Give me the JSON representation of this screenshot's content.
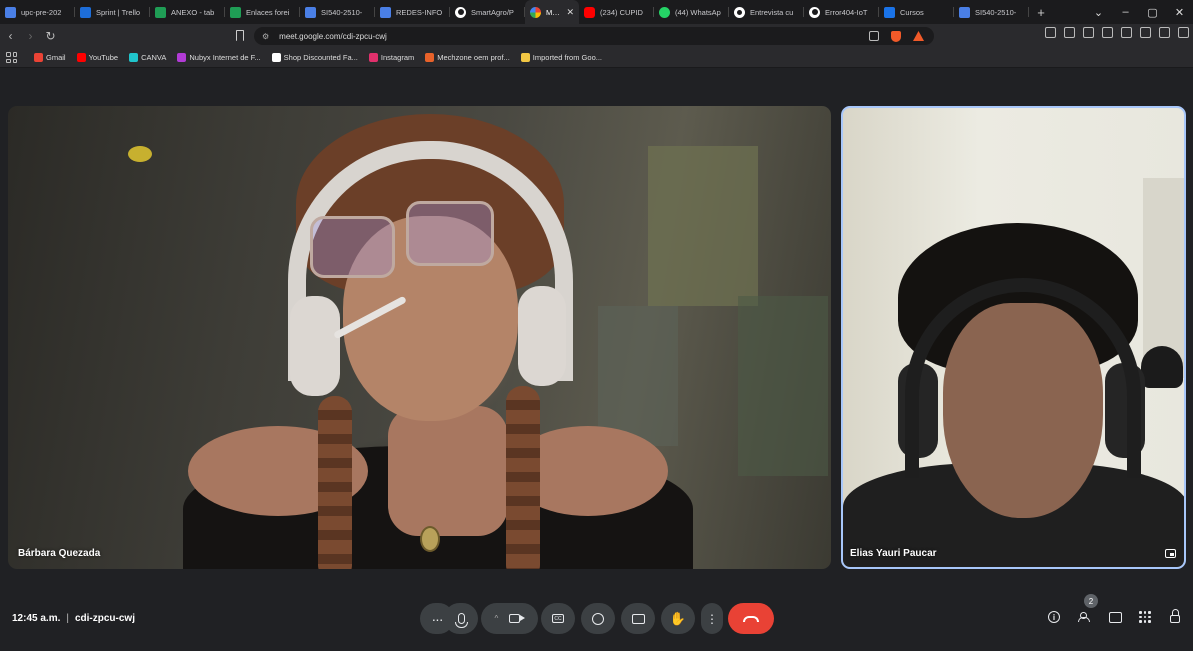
{
  "browser": {
    "tabs": [
      {
        "title": "upc-pre-202",
        "icon": "doc"
      },
      {
        "title": "Sprint | Trello",
        "icon": "trello"
      },
      {
        "title": "ANEXO - tab",
        "icon": "sheet"
      },
      {
        "title": "Enlaces forei",
        "icon": "sheet"
      },
      {
        "title": "SI540-2510-",
        "icon": "doc"
      },
      {
        "title": "REDES-INFO",
        "icon": "doc"
      },
      {
        "title": "SmartAgro/P",
        "icon": "gh"
      },
      {
        "title": "Meet",
        "icon": "meet",
        "active": true
      },
      {
        "title": "(234) CUPID",
        "icon": "yt"
      },
      {
        "title": "(44) WhatsAp",
        "icon": "wa"
      },
      {
        "title": "Entrevista cu",
        "icon": "circ"
      },
      {
        "title": "Error404-IoT",
        "icon": "gh"
      },
      {
        "title": "Cursos",
        "icon": "acad"
      },
      {
        "title": "SI540-2510-",
        "icon": "doc"
      }
    ],
    "new_tab": "+",
    "window_controls": {
      "dropdown": "⌄",
      "minimize": "–",
      "maximize": "▢",
      "close": "✕"
    },
    "nav": {
      "back": "‹",
      "forward": "›",
      "reload": "↻"
    },
    "url": "meet.google.com/cdi-zpcu-cwj",
    "bookmarks": [
      {
        "label": "Gmail",
        "color": "#ea4335"
      },
      {
        "label": "YouTube",
        "color": "#ff0000"
      },
      {
        "label": "CANVA",
        "color": "#20c4cb"
      },
      {
        "label": "Nubyx Internet de F...",
        "color": "#b23bd6"
      },
      {
        "label": "Shop Discounted Fa...",
        "color": "#ffffff"
      },
      {
        "label": "Instagram",
        "color": "#e1306c"
      },
      {
        "label": "Mechzone oem prof...",
        "color": "#e8622a"
      },
      {
        "label": "Imported from Goo...",
        "color": "#f2c744"
      }
    ]
  },
  "meet": {
    "participants": [
      {
        "name": "Bárbara Quezada"
      },
      {
        "name": "Elias Yauri Paucar"
      }
    ],
    "time": "12:45 a.m.",
    "separator": "|",
    "code": "cdi-zpcu-cwj",
    "people_count": "2",
    "controls": {
      "more_dots": "···",
      "chevron": "^",
      "cc_label": "CC",
      "hand": "✋",
      "kebab": "⋮",
      "info": "i"
    },
    "colors": {
      "end_call": "#e94235",
      "active_border": "#a8c7fa",
      "button_bg": "#3c4043"
    }
  }
}
